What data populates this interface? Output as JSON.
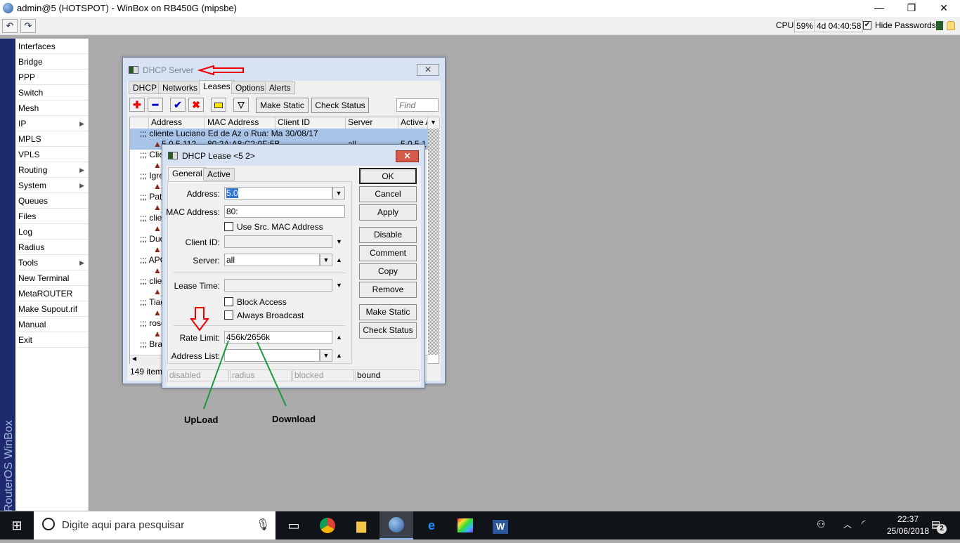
{
  "app": {
    "title": "admin@5        (HOTSPOT) - WinBox       on RB450G (mipsbe)",
    "window_controls": [
      "—",
      "❐",
      "✕"
    ]
  },
  "toolbar": {
    "undo": "↶",
    "redo": "↷",
    "cpu_label": "CPU:",
    "cpu_value": "59%",
    "uptime": "4d 04:40:58",
    "hide_passwords": "Hide Passwords",
    "hide_passwords_checked": true
  },
  "sidebar": {
    "brand": "RouterOS WinBox",
    "items": [
      {
        "label": "Interfaces"
      },
      {
        "label": "Bridge"
      },
      {
        "label": "PPP"
      },
      {
        "label": "Switch"
      },
      {
        "label": "Mesh"
      },
      {
        "label": "IP",
        "sub": true
      },
      {
        "label": "MPLS"
      },
      {
        "label": "VPLS"
      },
      {
        "label": "Routing",
        "sub": true
      },
      {
        "label": "System",
        "sub": true
      },
      {
        "label": "Queues"
      },
      {
        "label": "Files"
      },
      {
        "label": "Log"
      },
      {
        "label": "Radius"
      },
      {
        "label": "Tools",
        "sub": true
      },
      {
        "label": "New Terminal"
      },
      {
        "label": "MetaROUTER"
      },
      {
        "label": "Make Supout.rif"
      },
      {
        "label": "Manual"
      },
      {
        "label": "Exit"
      }
    ]
  },
  "dhcp_server": {
    "title": "DHCP Server",
    "tabs": [
      "DHCP",
      "Networks",
      "Leases",
      "Options",
      "Alerts"
    ],
    "active_tab": "Leases",
    "make_static": "Make Static",
    "check_status": "Check Status",
    "find_placeholder": "Find",
    "columns": [
      "Address",
      "MAC Address",
      "Client ID",
      "Server",
      "Active A"
    ],
    "rows": [
      {
        "group": ";;; cliente Luciano Ed      de Az      o Rua: Ma        30/08/17"
      },
      {
        "address": "5.0.5.112",
        "mac": "80:2A:A8:C2:0F:5B",
        "server": "all",
        "active": "5.0.5.1"
      },
      {
        "group": ";;; Clie"
      },
      {
        "address": ""
      },
      {
        "group": ";;; Igre"
      },
      {
        "address": ""
      },
      {
        "group": ";;; Patr"
      },
      {
        "address": ""
      },
      {
        "group": ";;; clie"
      },
      {
        "address": ""
      },
      {
        "group": ";;; Duc"
      },
      {
        "address": ""
      },
      {
        "group": ";;; APC"
      },
      {
        "address": ""
      },
      {
        "group": ";;; clie"
      },
      {
        "address": ""
      },
      {
        "group": ";;; Tiag"
      },
      {
        "address": ""
      },
      {
        "group": ";;; rose"
      },
      {
        "address": ""
      },
      {
        "group": ";;; Bra"
      }
    ],
    "items_count": "149 items"
  },
  "dhcp_lease": {
    "title": "DHCP Lease <5           2>",
    "tabs": [
      "General",
      "Active"
    ],
    "active_tab": "General",
    "fields": {
      "address_label": "Address:",
      "address": "5.0",
      "mac_label": "MAC Address:",
      "mac": "80:",
      "use_src_mac": "Use Src. MAC Address",
      "client_id_label": "Client ID:",
      "client_id": "",
      "server_label": "Server:",
      "server": "all",
      "lease_time_label": "Lease Time:",
      "lease_time": "",
      "block_access": "Block Access",
      "always_broadcast": "Always Broadcast",
      "rate_limit_label": "Rate Limit:",
      "rate_limit": "456k/2656k",
      "address_list_label": "Address List:",
      "address_list": ""
    },
    "buttons": [
      "OK",
      "Cancel",
      "Apply",
      "Disable",
      "Comment",
      "Copy",
      "Remove",
      "Make Static",
      "Check Status"
    ],
    "status": [
      "disabled",
      "radius",
      "blocked",
      "bound"
    ]
  },
  "annotations": {
    "upload": "UpLoad",
    "download": "Download"
  },
  "taskbar": {
    "search_placeholder": "Digite aqui para pesquisar",
    "time": "22:37",
    "date": "25/06/2018",
    "notifications": "2"
  }
}
